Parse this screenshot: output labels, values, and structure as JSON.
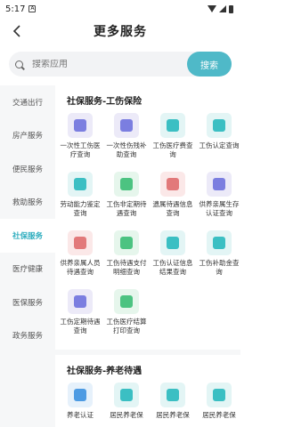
{
  "status": {
    "time": "5:17",
    "app_icon": "A"
  },
  "header": {
    "title": "更多服务",
    "back_icon": "chevron-left-icon"
  },
  "search": {
    "placeholder": "搜索应用",
    "button": "搜索"
  },
  "sidebar": {
    "items": [
      {
        "label": "交通出行",
        "active": false
      },
      {
        "label": "房产服务",
        "active": false
      },
      {
        "label": "便民服务",
        "active": false
      },
      {
        "label": "救助服务",
        "active": false
      },
      {
        "label": "社保服务",
        "active": true
      },
      {
        "label": "医疗健康",
        "active": false
      },
      {
        "label": "医保服务",
        "active": false
      },
      {
        "label": "政务服务",
        "active": false
      }
    ]
  },
  "sections": [
    {
      "title": "社保服务-工伤保险",
      "items": [
        {
          "label": "一次性工伤医疗查询",
          "color": "purple",
          "icon": "person-doc-icon"
        },
        {
          "label": "一次性伤残补助查询",
          "color": "purple",
          "icon": "id-card-icon"
        },
        {
          "label": "工伤医疗费查询",
          "color": "teal",
          "icon": "clipboard-icon"
        },
        {
          "label": "工伤认定查询",
          "color": "teal",
          "icon": "badge-icon"
        },
        {
          "label": "劳动能力鉴定查询",
          "color": "teal",
          "icon": "worker-icon"
        },
        {
          "label": "工伤非定期待遇查询",
          "color": "green",
          "icon": "document-icon"
        },
        {
          "label": "遗属待遇信息查询",
          "color": "red",
          "icon": "heart-person-icon"
        },
        {
          "label": "供养亲属生存认证查询",
          "color": "purple",
          "icon": "person-chart-icon"
        },
        {
          "label": "供养亲属人员待遇查询",
          "color": "red",
          "icon": "family-icon"
        },
        {
          "label": "工伤待遇支付明细查询",
          "color": "green",
          "icon": "yuan-icon"
        },
        {
          "label": "工伤认证信息结果查询",
          "color": "teal",
          "icon": "id-card-icon"
        },
        {
          "label": "工伤补助金查询",
          "color": "teal",
          "icon": "card-yuan-icon"
        },
        {
          "label": "工伤定期待遇查询",
          "color": "purple",
          "icon": "list-icon"
        },
        {
          "label": "工伤医疗结算打印查询",
          "color": "green",
          "icon": "medical-cross-icon"
        }
      ]
    },
    {
      "title": "社保服务-养老待遇",
      "items": [
        {
          "label": "养老认证",
          "color": "blue",
          "icon": "person-check-icon"
        },
        {
          "label": "居民养老保",
          "color": "teal",
          "icon": "shield-icon"
        },
        {
          "label": "居民养老保",
          "color": "teal",
          "icon": "person-card-icon"
        },
        {
          "label": "居民养老保",
          "color": "teal",
          "icon": "id-card-icon"
        }
      ]
    }
  ]
}
